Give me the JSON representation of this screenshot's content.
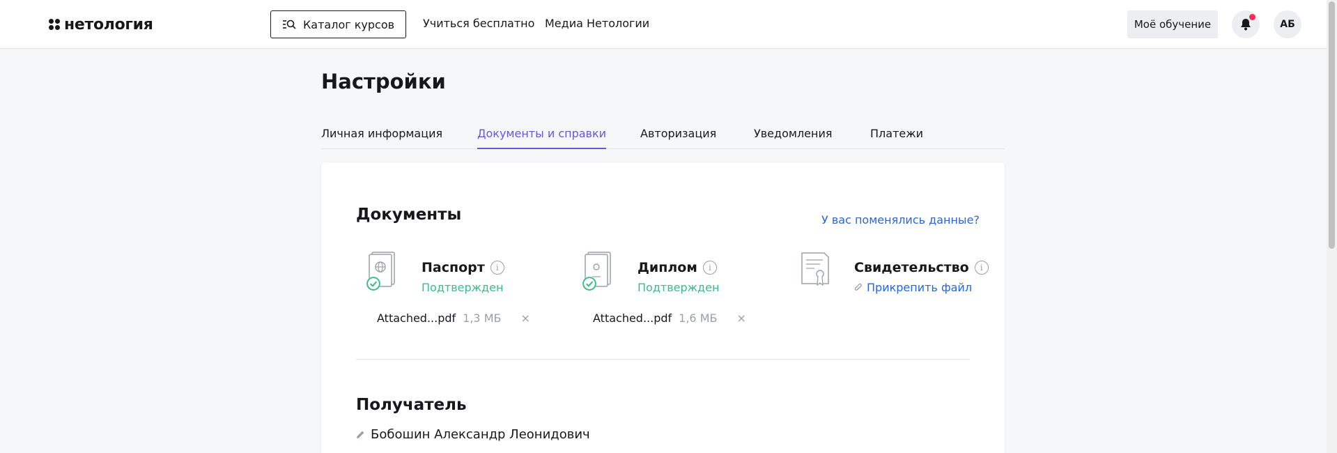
{
  "header": {
    "logo_text": "нетология",
    "catalog_label": "Каталог курсов",
    "nav": [
      "Учиться бесплатно",
      "Медиа Нетологии"
    ],
    "my_learning": "Моё обучение",
    "avatar_initials": "АБ",
    "notification_dot_color": "#ff2c5a"
  },
  "page": {
    "title": "Настройки",
    "tabs": [
      {
        "label": "Личная информация",
        "active": false
      },
      {
        "label": "Документы и справки",
        "active": true
      },
      {
        "label": "Авторизация",
        "active": false
      },
      {
        "label": "Уведомления",
        "active": false
      },
      {
        "label": "Платежи",
        "active": false
      }
    ]
  },
  "documents": {
    "title": "Документы",
    "change_link": "У вас поменялись данные?",
    "items": [
      {
        "title": "Паспорт",
        "status": "Подтвержден",
        "file_name": "Attached...pdf",
        "file_size": "1,3 МБ",
        "remove": "×"
      },
      {
        "title": "Диплом",
        "status": "Подтвержден",
        "file_name": "Attached...pdf",
        "file_size": "1,6 МБ",
        "remove": "×"
      },
      {
        "title": "Свидетельство",
        "attach_label": "Прикрепить файл"
      }
    ]
  },
  "recipient": {
    "title": "Получатель",
    "name": "Бобошин Александр Леонидович"
  },
  "colors": {
    "accent": "#6b56d8",
    "link": "#2a66d6",
    "success": "#3cbb8a"
  }
}
